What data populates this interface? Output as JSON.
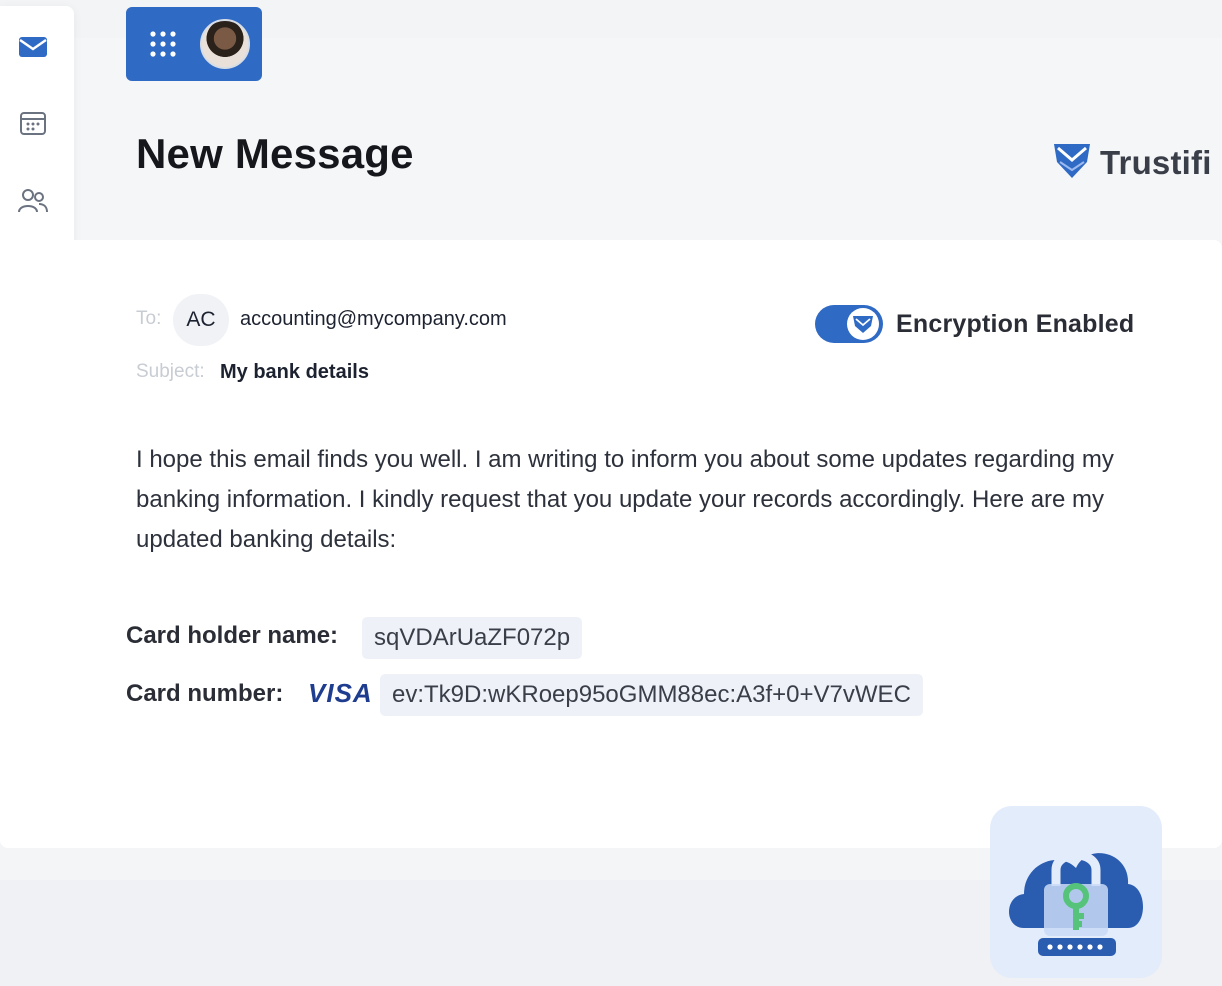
{
  "page": {
    "title": "New Message"
  },
  "brand": {
    "name": "Trustifi"
  },
  "sidebar": {
    "items": [
      {
        "name": "mail-icon",
        "color": "#2f6ac4"
      },
      {
        "name": "calendar-icon",
        "color": "#6b7280"
      },
      {
        "name": "contacts-icon",
        "color": "#6b7280"
      },
      {
        "name": "attachment-icon",
        "color": "#9aa0aa"
      },
      {
        "name": "todo-icon",
        "color": "#2f7de0"
      },
      {
        "name": "word-icon",
        "color": "#2b5ab8"
      },
      {
        "name": "excel-icon",
        "color": "#1e7b45"
      },
      {
        "name": "powerpoint-icon",
        "color": "#d14a26"
      },
      {
        "name": "onedrive-icon",
        "color": "#1a73d9"
      }
    ]
  },
  "email": {
    "to_label": "To:",
    "to_initials": "AC",
    "to_address": "accounting@mycompany.com",
    "subject_label": "Subject:",
    "subject": "My bank details",
    "encryption_label": "Encryption Enabled",
    "encryption_on": true,
    "body": "I hope this email finds you well. I am writing to inform you about some updates regarding my banking information. I kindly request that you update your records accordingly. Here are my updated banking details:",
    "card_holder_label": "Card holder name:",
    "card_holder_value": "sqVDArUaZF072p",
    "card_number_label": "Card number:",
    "card_brand": "VISA",
    "card_number_value": "ev:Tk9D:wKRoep95oGMM88ec:A3f+0+V7vWEC"
  },
  "colors": {
    "accent": "#2f6ac4",
    "brand_dark": "#3a3e48"
  }
}
